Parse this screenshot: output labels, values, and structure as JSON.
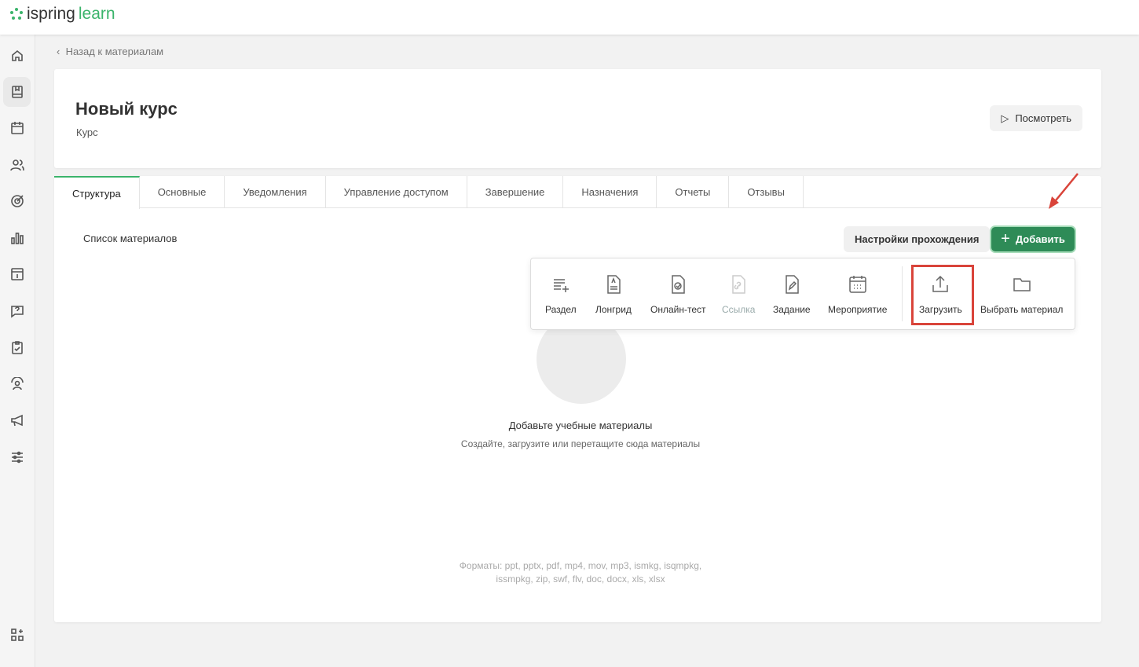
{
  "app": {
    "logo_a": "ispring",
    "logo_b": "learn"
  },
  "breadcrumb": {
    "back": "Назад к материалам"
  },
  "course": {
    "title": "Новый курс",
    "type": "Курс",
    "view_button": "Посмотреть"
  },
  "tabs": [
    "Структура",
    "Основные",
    "Уведомления",
    "Управление доступом",
    "Завершение",
    "Назначения",
    "Отчеты",
    "Отзывы"
  ],
  "structure": {
    "list_label": "Список материалов",
    "settings_button": "Настройки прохождения",
    "add_button": "Добавить"
  },
  "add_menu": [
    {
      "label": "Раздел",
      "icon": "section-icon"
    },
    {
      "label": "Лонгрид",
      "icon": "longread-icon"
    },
    {
      "label": "Онлайн-тест",
      "icon": "quiz-icon"
    },
    {
      "label": "Ссылка",
      "icon": "link-icon",
      "disabled": true
    },
    {
      "label": "Задание",
      "icon": "assignment-icon"
    },
    {
      "label": "Мероприятие",
      "icon": "event-icon"
    },
    {
      "label": "Загрузить",
      "icon": "upload-icon",
      "highlighted": true
    },
    {
      "label": "Выбрать материал",
      "icon": "folder-icon"
    }
  ],
  "empty": {
    "title": "Добавьте учебные материалы",
    "subtitle": "Создайте, загрузите или перетащите сюда материалы",
    "formats_line1": "Форматы: ppt, pptx, pdf, mp4, mov, mp3, ismkg, isqmpkg,",
    "formats_line2": "issmpkg, zip, swf, flv, doc, docx, xls, xlsx"
  },
  "colors": {
    "accent": "#3bb46b",
    "button": "#2e8b57",
    "highlight": "#d9443a"
  }
}
